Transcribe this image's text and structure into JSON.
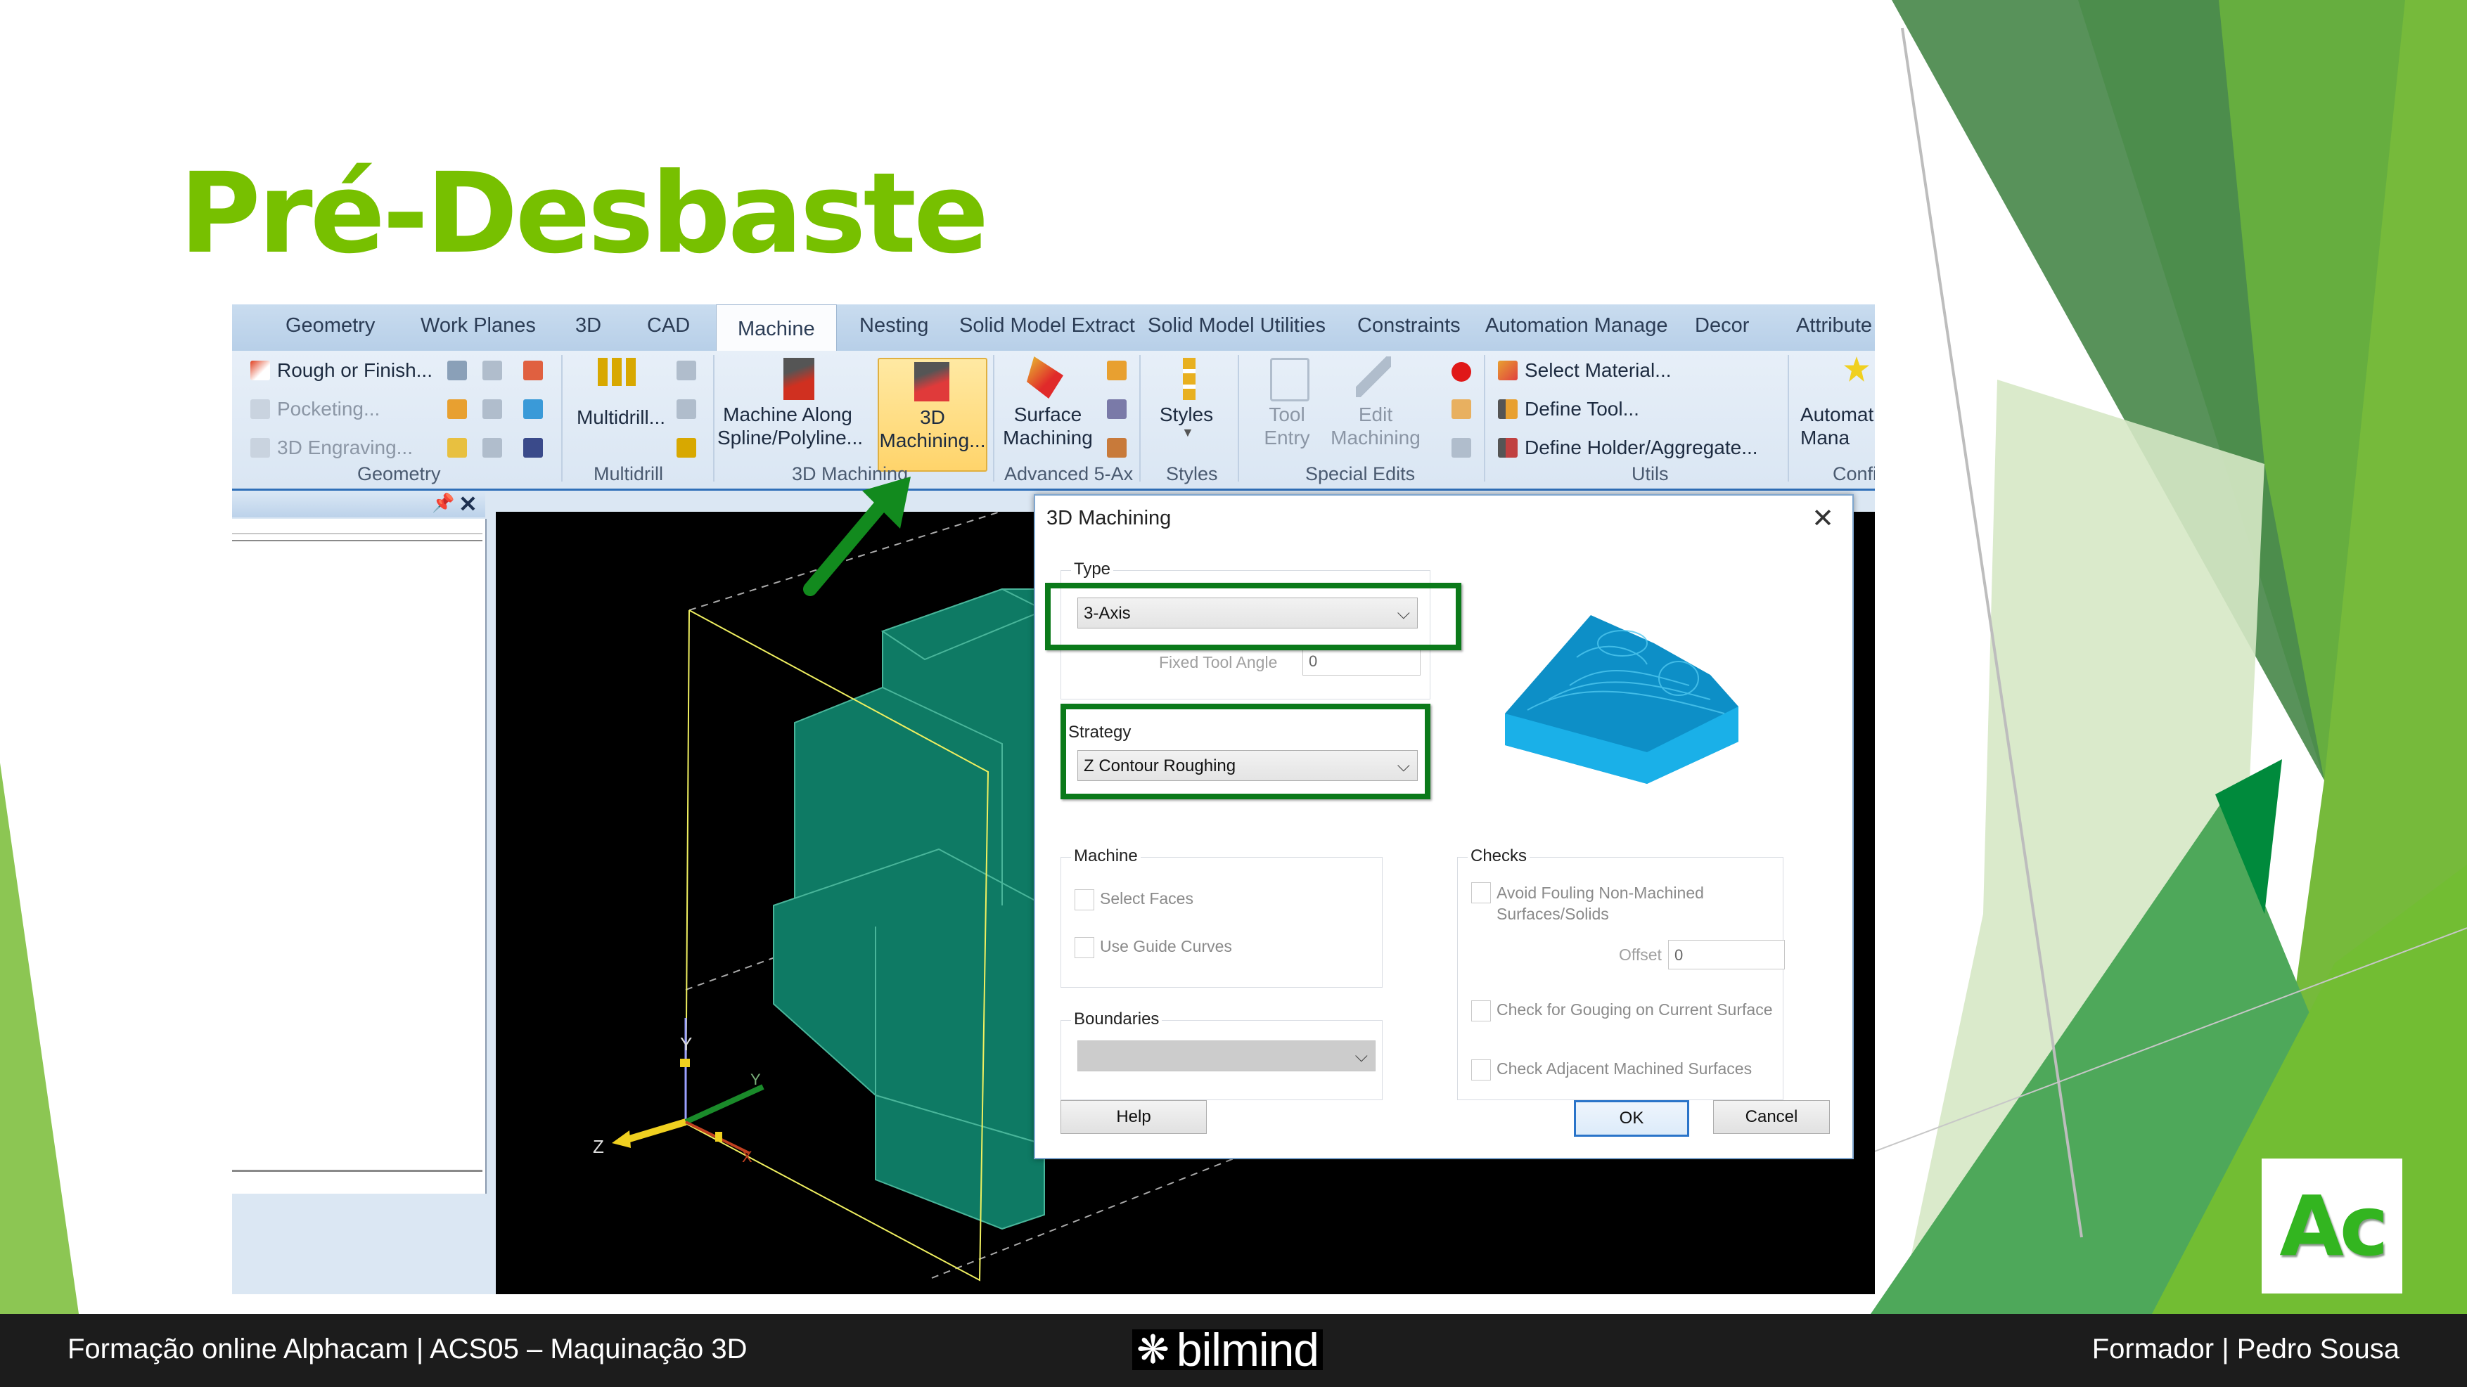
{
  "slide": {
    "title": "Pré-Desbaste",
    "colors": {
      "title": "#77c000",
      "highlight_box": "#0b7a1a",
      "footer_bg": "#1c1c1c"
    }
  },
  "ribbon": {
    "tabs": [
      {
        "label": "Geometry",
        "active": false
      },
      {
        "label": "Work Planes",
        "active": false
      },
      {
        "label": "3D",
        "active": false
      },
      {
        "label": "CAD",
        "active": false
      },
      {
        "label": "Machine",
        "active": true
      },
      {
        "label": "Nesting",
        "active": false
      },
      {
        "label": "Solid Model Extract",
        "active": false
      },
      {
        "label": "Solid Model Utilities",
        "active": false
      },
      {
        "label": "Constraints",
        "active": false
      },
      {
        "label": "Automation Manage",
        "active": false
      },
      {
        "label": "Decor",
        "active": false
      },
      {
        "label": "Attribute",
        "active": false
      }
    ],
    "groups": {
      "geometry": {
        "label": "Geometry",
        "items": [
          "Rough or Finish...",
          "Pocketing...",
          "3D Engraving..."
        ]
      },
      "multidrill": {
        "label": "Multidrill",
        "button": "Multidrill..."
      },
      "machining3d": {
        "label": "3D Machining",
        "buttons": [
          "Machine Along\nSpline/Polyline...",
          "3D\nMachining..."
        ]
      },
      "advanced": {
        "label": "Advanced 5-Ax",
        "button": "Surface\nMachining"
      },
      "styles": {
        "label": "Styles",
        "button": "Styles"
      },
      "special_edits": {
        "label": "Special Edits",
        "buttons": [
          "Tool\nEntry",
          "Edit\nMachining"
        ]
      },
      "utils": {
        "label": "Utils",
        "items": [
          "Select Material...",
          "Define Tool...",
          "Define Holder/Aggregate..."
        ]
      },
      "config": {
        "label": "Confi",
        "button": "Automat\nMana"
      }
    }
  },
  "viewport": {
    "axes": [
      "X",
      "Y",
      "Z"
    ]
  },
  "dialog": {
    "title": "3D Machining",
    "type": {
      "legend": "Type",
      "value": "3-Axis",
      "fixed_tool_angle_label": "Fixed Tool Angle",
      "fixed_tool_angle_value": "0"
    },
    "strategy": {
      "legend": "Strategy",
      "value": "Z Contour Roughing"
    },
    "machine": {
      "legend": "Machine",
      "options": [
        {
          "label": "Select Faces",
          "checked": false
        },
        {
          "label": "Use Guide Curves",
          "checked": false
        }
      ]
    },
    "boundaries": {
      "legend": "Boundaries",
      "value": ""
    },
    "checks": {
      "legend": "Checks",
      "avoid_fouling": {
        "label": "Avoid Fouling Non-Machined\nSurfaces/Solids",
        "checked": false
      },
      "offset_label": "Offset",
      "offset_value": "0",
      "gouging": {
        "label": "Check for Gouging on Current Surface",
        "checked": false
      },
      "adjacent": {
        "label": "Check Adjacent Machined Surfaces",
        "checked": false
      }
    },
    "buttons": {
      "help": "Help",
      "ok": "OK",
      "cancel": "Cancel"
    }
  },
  "footer": {
    "left": "Formação online Alphacam | ACS05 – Maquinação 3D",
    "logo_text": "bilmind",
    "right": "Formador | Pedro Sousa"
  },
  "corner_logo": {
    "text": "Ac"
  }
}
